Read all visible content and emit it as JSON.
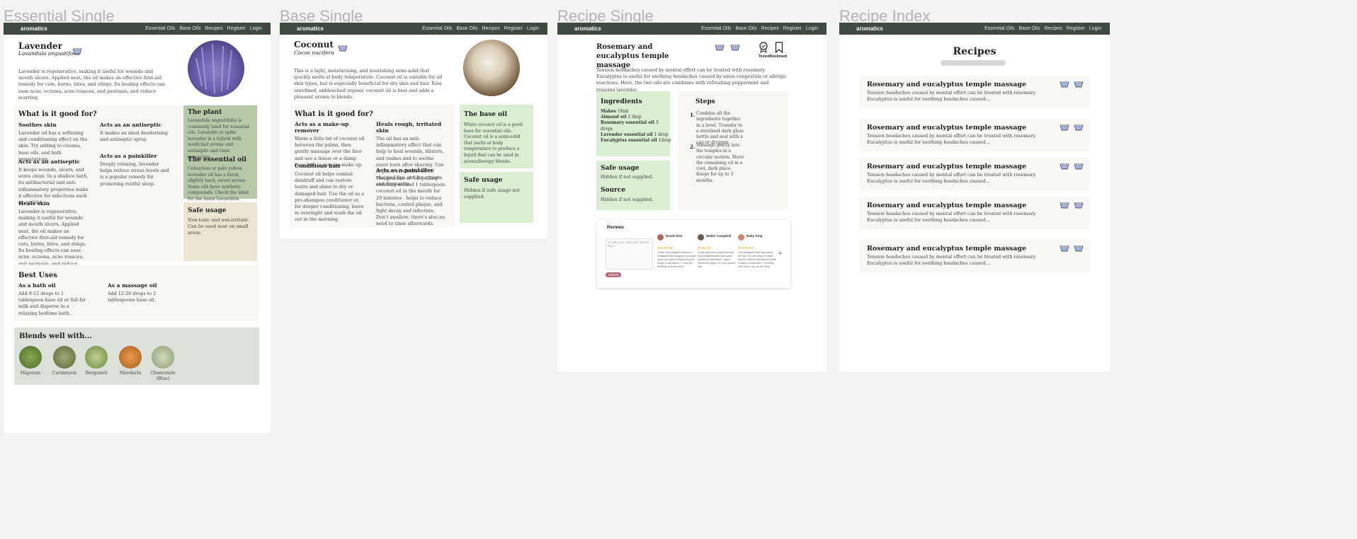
{
  "frames": {
    "essential_single": "Essential Single",
    "base_single": "Base Single",
    "recipe_single": "Recipe Single",
    "recipe_index": "Recipe Index"
  },
  "nav": {
    "brand": "aromatics",
    "links": [
      "Essential Oils",
      "Base Oils",
      "Recipes",
      "Register",
      "Login"
    ]
  },
  "essential": {
    "title": "Lavender",
    "latin": "Lavandula angustifolia",
    "intro": "Lavender is regenerative, making it useful for wounds and mouth ulcers. Applied neat, the oil makes an effective first-aid remedy for cuts, burns, bites, and stings. Its healing effects can ease acne, eczema, acne rosacea, and psoriasis, and reduce scarring",
    "good_for_title": "What is it good for?",
    "good_for": [
      {
        "title": "Soothes skin",
        "text": "Lavender oil has a softening and conditioning effect on the skin. Try adding to creams, base oils, and bath preparations."
      },
      {
        "title": "Acts as an antiseptic",
        "text": "It keeps wounds, ulcers, and sores clean. In a shallow bath, its antibacterial and anti-inflammatory properties make it effective for infections such as cystitis."
      },
      {
        "title": "Heals skin",
        "text": "Lavender is regenerative, making it useful for wounds and mouth ulcers. Applied neat, the oil makes an effective first-aid remedy for cuts, burns, bites, and stings. Its healing effects can ease acne, eczema, acne rosacea, and psoriasis, and reduce scarring."
      },
      {
        "title": "Acts as an antiseptic",
        "text": "It makes an ideal deodorising and antiseptic spray."
      },
      {
        "title": "Acts as a painkiller",
        "text": "Deeply relaxing, lavender helps reduce stress levels and is a popular remedy for promoting restful sleep."
      }
    ],
    "plant_title": "The plant",
    "plant_text": "Lavandula angustifolia is commonly used for essential oils. Lavandin or spike lavender is a hybrid with medicinal aroma and antiseptic and tonic properties.",
    "oil_title": "The essential oil",
    "oil_text": "Colourless or pale yellow, lavender oil has a floral, slightly hard, sweet aroma. Some oils have synthetic compounds. Check the label for the name Lavandula angustifolia.",
    "safe_title": "Safe usage",
    "safe_text": "Non-toxic and non-irritant. Can be used neat on small areas.",
    "best_uses_title": "Best Uses",
    "best_uses": [
      {
        "title": "As a bath oil",
        "text": "Add 8-12 drops to 1 tablespoon base oil or full-fat milk and disperse in a relaxing bedtime bath."
      },
      {
        "title": "As a massage oil",
        "text": "Add 12-20 drops to 2 tablespoons base oil."
      }
    ],
    "blends_title": "Blends well with...",
    "blends": [
      "Majoram",
      "Cardamom",
      "Bergamot",
      "Mandarin",
      "Chamomile (Blue)"
    ],
    "blend_colors": [
      "#6b8a3a",
      "#7a8a4a",
      "#8aa05a",
      "#d08a3a",
      "#a8b890"
    ]
  },
  "base": {
    "title": "Coconut",
    "latin": "Cocos nucifera",
    "intro": "This is a light, moisturising, and nourishing semi-solid that quickly melts at body temperature. Coconut oil is suitable for all skin types, but is especially beneficial for dry skin and hair. Raw, unrefined, unbleached organic coconut oil is best and adds a pleasant aroma to blends.",
    "good_for_title": "What is it good for?",
    "good_for": [
      {
        "title": "Acts as a make-up remover",
        "text": "Warm a little bit of coconut oil between the palms, then gently massage over the face and use a tissue or a damp facecloth to remove make up."
      },
      {
        "title": "Conditions hair",
        "text": "Coconut oil helps combat dandruff and can restore lustre and shine to dry or damaged hair. Use the oil as a pre-shampoo conditioner or, for deeper conditioning, leave in overnight and wash the oil out in the morning."
      },
      {
        "title": "Heals rough, irritated skin",
        "text": "The oil has an anti-inflammatory effect that can help to heal wounds, blisters, and rashes and to soothe razor burn after shaving. Use in place of mineral oil for chapped lips and for eczema and dermatitis."
      },
      {
        "title": "Acts as a painkiller",
        "text": "The practice of \"oil-pulling\" - swishing around 1 tablespoon coconut oil in the mouth for 20 minutes - helps to reduce bacteria, control plaque, and fight decay and infection. Don't swallow; there's also no need to rinse afterwards."
      }
    ],
    "base_title": "The base oil",
    "base_text": "White coconut oil is a good base for essential oils. Coconut oil is a semi-solid that melts at body temperature to produce a liquid that can be used in aromatherapy blends.",
    "safe_title": "Safe usage",
    "safe_text": "Hidden if safe usage not supplied."
  },
  "recipe": {
    "title": "Rosemary and eucalyptus temple massage",
    "tested_label": "Tested",
    "bookmark_label": "Bookmark",
    "intro": "Tension headaches caused by mental effort can be treated with rosemary. Eucalyptus is useful for soothing headaches caused by sinus congestion or allergic reactions. Here, the two oils are combines with refreshing peppermint and relaxing lavender.",
    "ingredients_title": "Ingredients",
    "ingredients": [
      {
        "name": "Makes",
        "qty": "10ml"
      },
      {
        "name": "Almond oil",
        "qty": "2 tbsp"
      },
      {
        "name": "Rosemary essential oil",
        "qty": "3 drops"
      },
      {
        "name": "Lavender essential oil",
        "qty": "1 drop"
      },
      {
        "name": "Eucalyptus essential oil",
        "qty": "1drop"
      }
    ],
    "steps_title": "Steps",
    "steps": [
      {
        "num": "1.",
        "text": "Combine all the ingredients together in a bowl. Transfer to a sterilised dark glass bottle and seal with a cap or dropper."
      },
      {
        "num": "2.",
        "text": "Massage gently into the temples in a circular motion. Store the remaining oil in a cool, dark place. Keeps for up to 3 months."
      }
    ],
    "safe_title": "Safe usage",
    "safe_text": "Hidden if not supplied.",
    "source_title": "Source",
    "source_text": "Hidden if not supplied.",
    "reviews_title": "Reviews",
    "review_placeholder": "To add your comment, please log in",
    "submit_label": "Submit",
    "reviews": [
      {
        "name": "Daniel Kite",
        "stars": "★★★★★",
        "text": "I have used Wigzil to transform Instagram feed plugin for a couple years and have nothing but good things to say about it. I love the flexibility and amount of"
      },
      {
        "name": "Walter Campbell",
        "stars": "★★★★☆",
        "text": "A very well done plugin that was very straightforward and works exactly as advertised. I gave Facebook plugin I've ever worked with"
      },
      {
        "name": "Ruby King",
        "stars": "★★★★★",
        "text": "This Instagram feed app saved the day! I'm very easy to install and the options and layouts make it easy to customize it. Honestly, can't wait to try out the other Widgets"
      }
    ],
    "read_more": "Read more"
  },
  "index": {
    "title": "Recipes",
    "cards": [
      {
        "title": "Rosemary and eucalyptus temple massage",
        "text": "Tension headaches caused by mental effort can be treated with rosemary. Eucalyptus is useful for soothing headaches caused..."
      },
      {
        "title": "Rosemary and eucalyptus temple massage",
        "text": "Tension headaches caused by mental effort can be treated with rosemary. Eucalyptus is useful for soothing headaches caused..."
      },
      {
        "title": "Rosemary and eucalyptus temple massage",
        "text": "Tension headaches caused by mental effort can be treated with rosemary. Eucalyptus is useful for soothing headaches caused..."
      },
      {
        "title": "Rosemary and eucalyptus temple massage",
        "text": "Tension headaches caused by mental effort can be treated with rosemary. Eucalyptus is useful for soothing headaches caused..."
      },
      {
        "title": "Rosemary and eucalyptus temple massage",
        "text": "Tension headaches caused by mental effort can be treated with rosemary. Eucalyptus is useful for soothing headaches caused..."
      }
    ]
  },
  "icons": [
    "bowl-icon",
    "award-icon",
    "bookmark-icon",
    "arrow-right-icon",
    "verified-icon"
  ],
  "colors": {
    "nav": "#3f4a40",
    "green_dark": "#b5c9a8",
    "green_light": "#d9eed2",
    "beige": "#ece4d2",
    "submit": "#b56a7a"
  }
}
